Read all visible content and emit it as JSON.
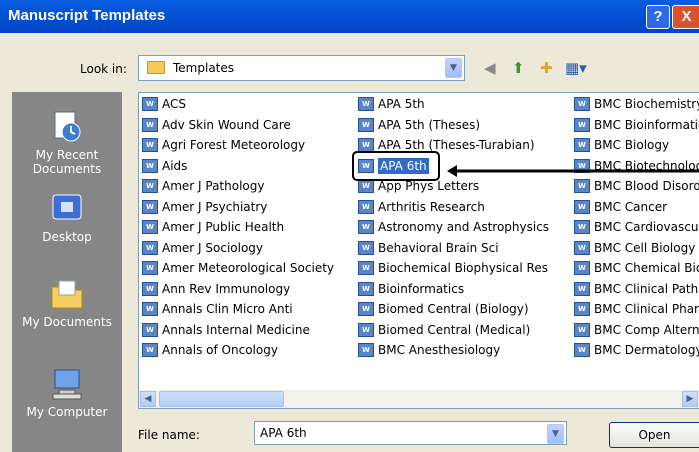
{
  "window": {
    "title": "Manuscript Templates",
    "help_label": "?",
    "close_label": "X"
  },
  "lookin": {
    "label": "Look in:",
    "value": "Templates"
  },
  "places": [
    {
      "label": "My Recent Documents"
    },
    {
      "label": "Desktop"
    },
    {
      "label": "My Documents"
    },
    {
      "label": "My Computer"
    }
  ],
  "columns": [
    [
      "ACS",
      "Adv Skin Wound Care",
      "Agri Forest Meteorology",
      "Aids",
      "Amer J Pathology",
      "Amer J Psychiatry",
      "Amer J Public Health",
      "Amer J Sociology",
      "Amer Meteorological Society",
      "Ann Rev Immunology",
      "Annals Clin Micro Anti",
      "Annals Internal Medicine",
      "Annals of Oncology"
    ],
    [
      "APA 5th",
      "APA 5th (Theses)",
      "APA 5th (Theses-Turabian)",
      "APA 6th",
      "App Phys Letters",
      "Arthritis Research",
      "Astronomy and Astrophysics",
      "Behavioral Brain Sci",
      "Biochemical Biophysical Res",
      "Bioinformatics",
      "Biomed Central (Biology)",
      "Biomed Central (Medical)",
      "BMC Anesthesiology"
    ],
    [
      "BMC Biochemistry",
      "BMC Bioinformatics",
      "BMC Biology",
      "BMC Biotechnology",
      "BMC Blood Disorders",
      "BMC Cancer",
      "BMC Cardiovascular",
      "BMC Cell Biology",
      "BMC Chemical Biology",
      "BMC Clinical Pathology",
      "BMC Clinical Pharmacology",
      "BMC Comp Alternative",
      "BMC Dermatology"
    ]
  ],
  "selected": "APA 6th",
  "filename": {
    "label": "File name:",
    "value": "APA 6th"
  },
  "open_label": "Open",
  "colors": {
    "titlebar": "#0551d6",
    "selection": "#316ac5",
    "places_bg": "#868686"
  }
}
